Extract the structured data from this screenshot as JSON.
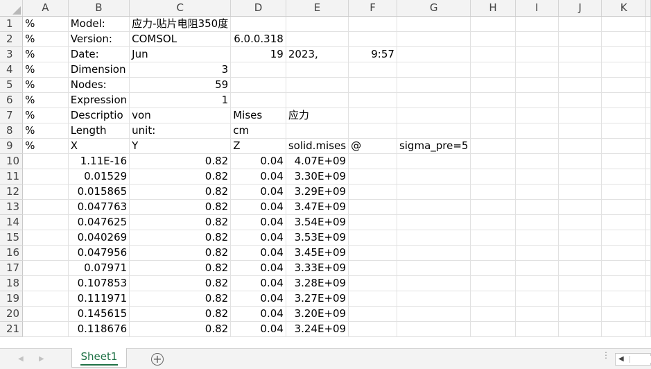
{
  "columns": [
    "A",
    "B",
    "C",
    "D",
    "E",
    "F",
    "G",
    "H",
    "I",
    "J",
    "K"
  ],
  "rows": [
    {
      "n": "1",
      "cells": [
        "%",
        "Model:",
        "应力-贴片电阻350度",
        "",
        "",
        "",
        "",
        "",
        "",
        "",
        ""
      ]
    },
    {
      "n": "2",
      "cells": [
        "%",
        "Version:",
        "COMSOL",
        "6.0.0.318",
        "",
        "",
        "",
        "",
        "",
        "",
        ""
      ]
    },
    {
      "n": "3",
      "cells": [
        "%",
        "Date:",
        "Jun",
        "19",
        "2023,",
        "9:57",
        "",
        "",
        "",
        "",
        ""
      ]
    },
    {
      "n": "4",
      "cells": [
        "%",
        "Dimension",
        "3",
        "",
        "",
        "",
        "",
        "",
        "",
        "",
        ""
      ]
    },
    {
      "n": "5",
      "cells": [
        "%",
        "Nodes:",
        "59",
        "",
        "",
        "",
        "",
        "",
        "",
        "",
        ""
      ]
    },
    {
      "n": "6",
      "cells": [
        "%",
        "Expression",
        "1",
        "",
        "",
        "",
        "",
        "",
        "",
        "",
        ""
      ]
    },
    {
      "n": "7",
      "cells": [
        "%",
        "Descriptio",
        "von",
        "Mises",
        "应力",
        "",
        "",
        "",
        "",
        "",
        ""
      ]
    },
    {
      "n": "8",
      "cells": [
        "%",
        "Length",
        "unit:",
        "cm",
        "",
        "",
        "",
        "",
        "",
        "",
        ""
      ]
    },
    {
      "n": "9",
      "cells": [
        "%",
        "X",
        "Y",
        "Z",
        "solid.mises",
        "@",
        "sigma_pre=5",
        "",
        "",
        "",
        ""
      ]
    },
    {
      "n": "10",
      "cells": [
        "",
        "1.11E-16",
        "0.82",
        "0.04",
        "4.07E+09",
        "",
        "",
        "",
        "",
        "",
        ""
      ]
    },
    {
      "n": "11",
      "cells": [
        "",
        "0.01529",
        "0.82",
        "0.04",
        "3.30E+09",
        "",
        "",
        "",
        "",
        "",
        ""
      ]
    },
    {
      "n": "12",
      "cells": [
        "",
        "0.015865",
        "0.82",
        "0.04",
        "3.29E+09",
        "",
        "",
        "",
        "",
        "",
        ""
      ]
    },
    {
      "n": "13",
      "cells": [
        "",
        "0.047763",
        "0.82",
        "0.04",
        "3.47E+09",
        "",
        "",
        "",
        "",
        "",
        ""
      ]
    },
    {
      "n": "14",
      "cells": [
        "",
        "0.047625",
        "0.82",
        "0.04",
        "3.54E+09",
        "",
        "",
        "",
        "",
        "",
        ""
      ]
    },
    {
      "n": "15",
      "cells": [
        "",
        "0.040269",
        "0.82",
        "0.04",
        "3.53E+09",
        "",
        "",
        "",
        "",
        "",
        ""
      ]
    },
    {
      "n": "16",
      "cells": [
        "",
        "0.047956",
        "0.82",
        "0.04",
        "3.45E+09",
        "",
        "",
        "",
        "",
        "",
        ""
      ]
    },
    {
      "n": "17",
      "cells": [
        "",
        "0.07971",
        "0.82",
        "0.04",
        "3.33E+09",
        "",
        "",
        "",
        "",
        "",
        ""
      ]
    },
    {
      "n": "18",
      "cells": [
        "",
        "0.107853",
        "0.82",
        "0.04",
        "3.28E+09",
        "",
        "",
        "",
        "",
        "",
        ""
      ]
    },
    {
      "n": "19",
      "cells": [
        "",
        "0.111971",
        "0.82",
        "0.04",
        "3.27E+09",
        "",
        "",
        "",
        "",
        "",
        ""
      ]
    },
    {
      "n": "20",
      "cells": [
        "",
        "0.145615",
        "0.82",
        "0.04",
        "3.20E+09",
        "",
        "",
        "",
        "",
        "",
        ""
      ]
    },
    {
      "n": "21",
      "cells": [
        "",
        "0.118676",
        "0.82",
        "0.04",
        "3.24E+09",
        "",
        "",
        "",
        "",
        "",
        ""
      ]
    }
  ],
  "numeric_cells": {
    "3": [
      3,
      5
    ],
    "4": [
      2
    ],
    "5": [
      2
    ],
    "6": [
      2
    ]
  },
  "sheet_tab": "Sheet1",
  "icons": {
    "prev_sheet": "chevron-left-icon",
    "next_sheet": "chevron-right-icon",
    "add_sheet": "plus-circle-icon",
    "scroll_left": "caret-left-icon"
  },
  "colors": {
    "header_bg": "#f3f3f3",
    "gridline": "#e1e1e1",
    "sheet_tab_text": "#1e7145"
  }
}
